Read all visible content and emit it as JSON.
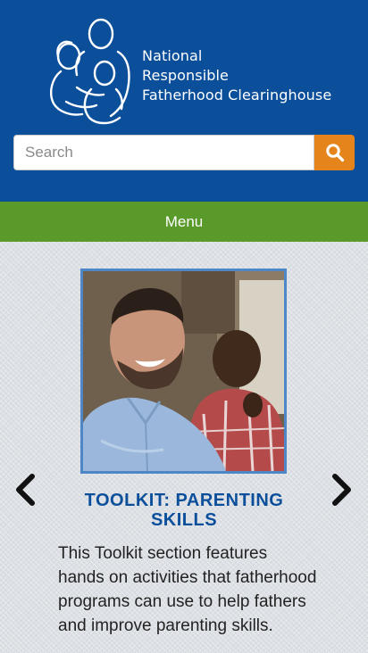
{
  "header": {
    "logo": {
      "line1": "National",
      "line2": "Responsible",
      "line3": "Fatherhood Clearinghouse",
      "icon": "family-icon"
    },
    "search": {
      "placeholder": "Search",
      "button_icon": "search-icon"
    },
    "colors": {
      "background": "#0b4f9b",
      "search_button": "#e5841b"
    }
  },
  "menu": {
    "label": "Menu",
    "color": "#5a9a2a"
  },
  "slide": {
    "title_line1": "TOOLKIT: PARENTING",
    "title_line2": "SKILLS",
    "description": "This Toolkit section features hands on activities that fatherhood programs can use to help fathers and improve parenting skills.",
    "prev_icon": "chevron-left-icon",
    "next_icon": "chevron-right-icon"
  }
}
